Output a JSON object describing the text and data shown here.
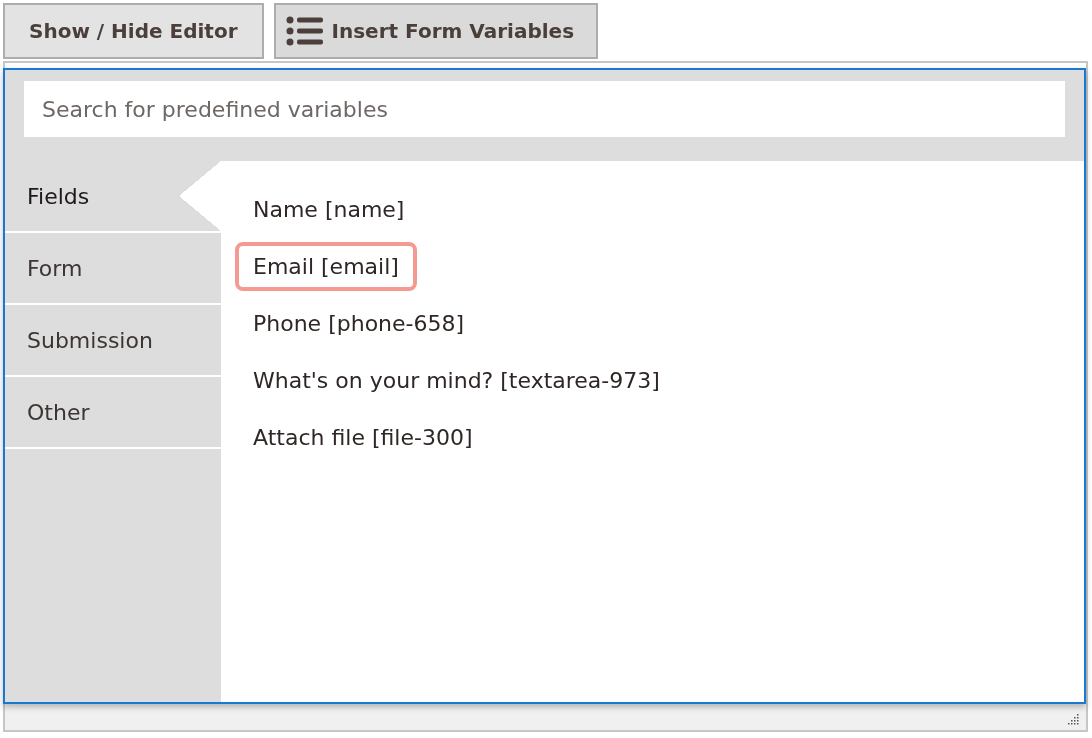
{
  "toolbar": {
    "buttons": [
      {
        "label": "Show / Hide Editor",
        "kind": "plain"
      },
      {
        "label": "Insert Form Variables",
        "kind": "list-icon"
      }
    ]
  },
  "popup": {
    "search": {
      "placeholder": "Search for predefined variables"
    },
    "tabs": [
      {
        "label": "Fields",
        "selected": true
      },
      {
        "label": "Form",
        "selected": false
      },
      {
        "label": "Submission",
        "selected": false
      },
      {
        "label": "Other",
        "selected": false
      }
    ],
    "variables": [
      {
        "label": "Name [name]",
        "selected": false
      },
      {
        "label": "Email [email]",
        "selected": true
      },
      {
        "label": "Phone [phone-658]",
        "selected": false
      },
      {
        "label": "What's on your mind? [textarea-973]",
        "selected": false
      },
      {
        "label": "Attach file [file-300]",
        "selected": false
      }
    ]
  }
}
